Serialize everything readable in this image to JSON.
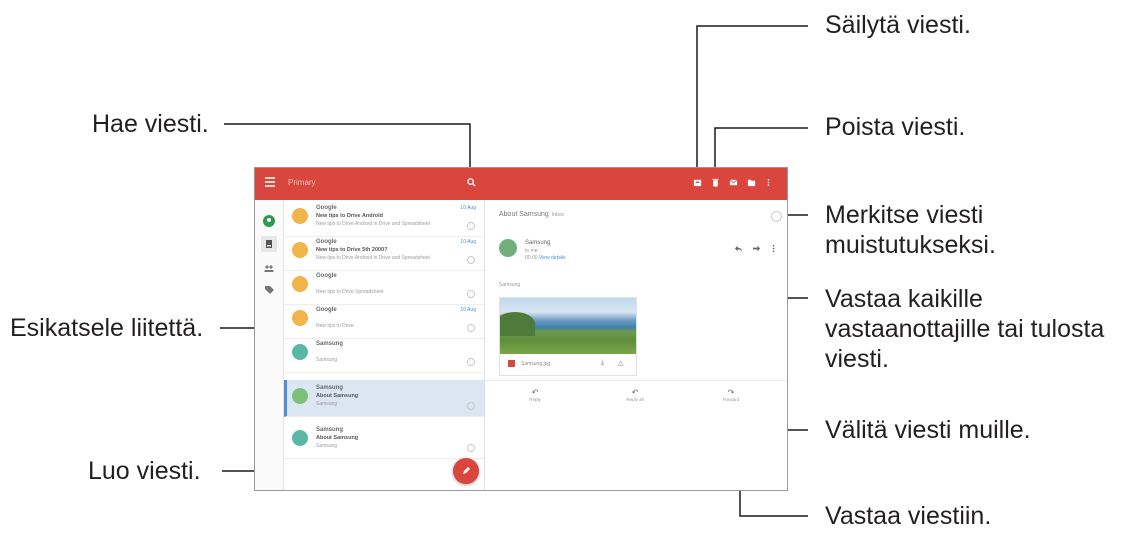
{
  "callouts": {
    "keep": "Säilytä viesti.",
    "delete": "Poista viesti.",
    "search": "Hae viesti.",
    "remind": [
      "Merkitse viesti",
      "muistutukseksi."
    ],
    "more": [
      "Vastaa kaikille",
      "vastaanottajille tai tulosta",
      "viesti."
    ],
    "preview": "Esikatsele liitettä.",
    "forward": "Välitä viesti muille.",
    "compose": "Luo viesti.",
    "reply": "Vastaa viestiin."
  },
  "app": {
    "title": "Primary",
    "colors": {
      "appbar": "#d9463e",
      "selected_row": "#dbe6f3",
      "accent": "#4a90d9"
    }
  },
  "list": [
    {
      "sender": "Google",
      "subject": "New tips to Drive Android",
      "snippet": "New tips to Drive Android in Drive and Spreadsheet",
      "date": "10 Aug",
      "avatar": "#f0b44a"
    },
    {
      "sender": "Google",
      "subject": "New tips to Drive 5th 2000?",
      "snippet": "New tips to Drive Android in Drive and Spreadsheet",
      "date": "10 Aug",
      "avatar": "#f0b44a"
    },
    {
      "sender": "Google",
      "subject": "",
      "snippet": "New tips to Drive Spreadsheet",
      "date": "",
      "avatar": "#f0b44a"
    },
    {
      "sender": "Google",
      "subject": "",
      "snippet": "New tips to Drive",
      "date": "10 Aug",
      "avatar": "#f0b44a"
    },
    {
      "sender": "Samsung",
      "subject": "",
      "snippet": "Samsung",
      "date": "",
      "avatar": "#5bb8a6"
    },
    {
      "sender": "Samsung",
      "subject": "About Samsung",
      "snippet": "Samsung",
      "date": "",
      "avatar": "#7cc07a"
    },
    {
      "sender": "Samsung",
      "subject": "About Samsung",
      "snippet": "Samsung",
      "date": "",
      "avatar": "#5bb8a6"
    }
  ],
  "detail": {
    "subject": "About Samsung",
    "subject_tag": "Inbox",
    "sender": "Samsung",
    "to": "to me",
    "date_text": "00:00",
    "date_link": "View details",
    "body": "Samsung",
    "attachment_name": "Samsung.jpg",
    "reply_labels": [
      "Reply",
      "Reply all",
      "Forward"
    ]
  }
}
